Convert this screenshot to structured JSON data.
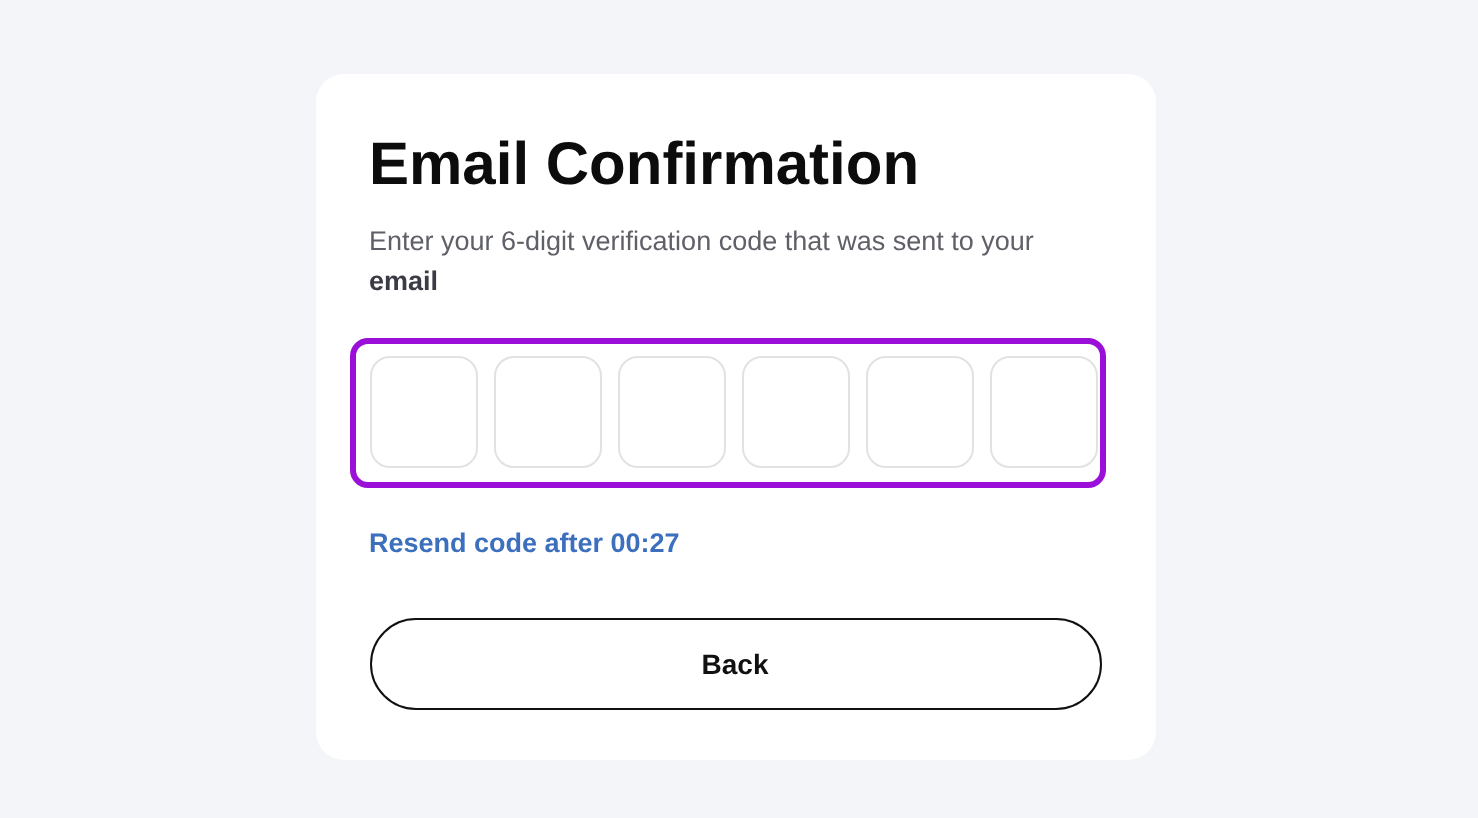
{
  "title": "Email Confirmation",
  "instructions": "Enter your 6-digit verification code that was sent to your **email**",
  "code_inputs": {
    "highlighted": true,
    "boxes": [
      {
        "kind": "digit"
      },
      {
        "kind": "digit"
      },
      {
        "kind": "digit"
      },
      {
        "kind": "digit"
      },
      {
        "kind": "digit"
      },
      {
        "kind": "digit"
      }
    ]
  },
  "resend_link": "Resend code after 00:27",
  "back_button": "Back"
}
